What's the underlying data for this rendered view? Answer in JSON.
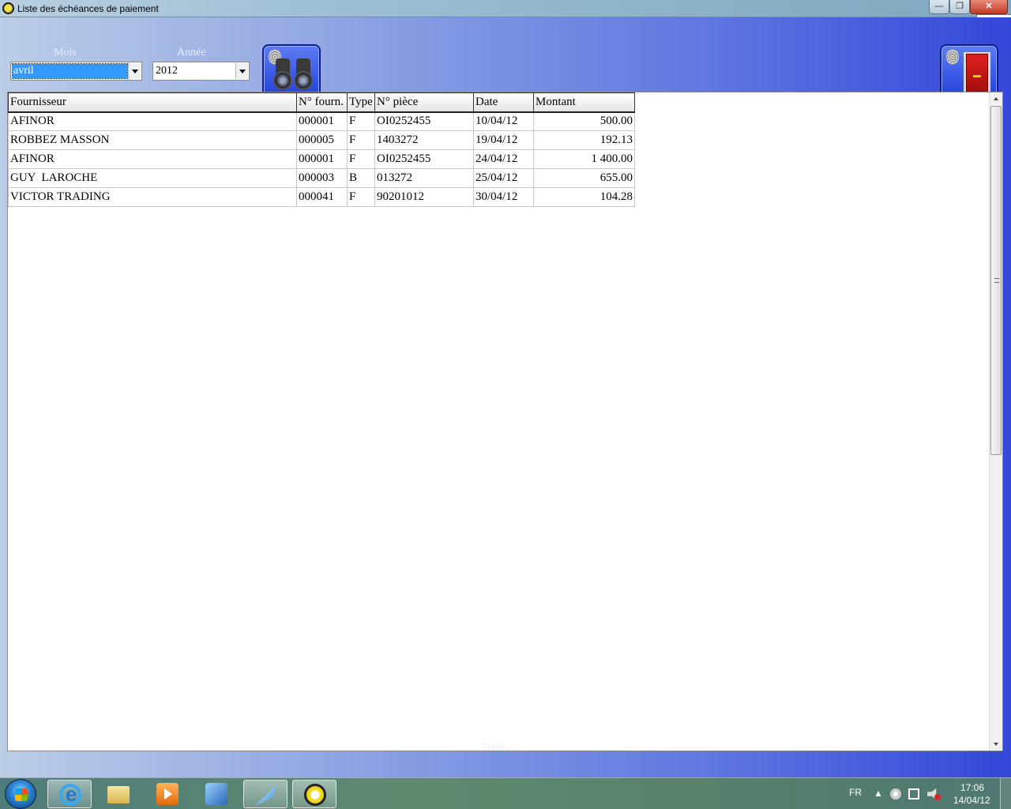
{
  "window": {
    "title": "Liste des échéances de paiement",
    "tooltip": "Fermer"
  },
  "filters": {
    "month_label": "Mois",
    "month_value": "avril",
    "year_label": "Année",
    "year_value": "2012"
  },
  "table": {
    "columns": [
      "Fournisseur",
      "N° fourn.",
      "Type",
      "N° pièce",
      "Date",
      "Montant"
    ],
    "rows": [
      [
        "AFINOR",
        "000001",
        "F",
        "OI0252455",
        "10/04/12",
        "500.00"
      ],
      [
        "ROBBEZ MASSON",
        "000005",
        "F",
        "1403272",
        "19/04/12",
        "192.13"
      ],
      [
        "AFINOR",
        "000001",
        "F",
        "OI0252455",
        "24/04/12",
        "1 400.00"
      ],
      [
        "GUY  LAROCHE",
        "000003",
        "B",
        "013272",
        "25/04/12",
        "655.00"
      ],
      [
        "VICTOR TRADING",
        "000041",
        "F",
        "90201012",
        "30/04/12",
        "104.28"
      ]
    ]
  },
  "footer": {
    "total_label": "Total :",
    "total_value": "2851.41"
  },
  "taskbar": {
    "language": "FR",
    "tray_expand": "▲",
    "time": "17:06",
    "date": "14/04/12"
  },
  "icons": {
    "app": "app-ring-icon",
    "search_button": "binoculars-icon",
    "exit_button": "door-exit-icon"
  }
}
